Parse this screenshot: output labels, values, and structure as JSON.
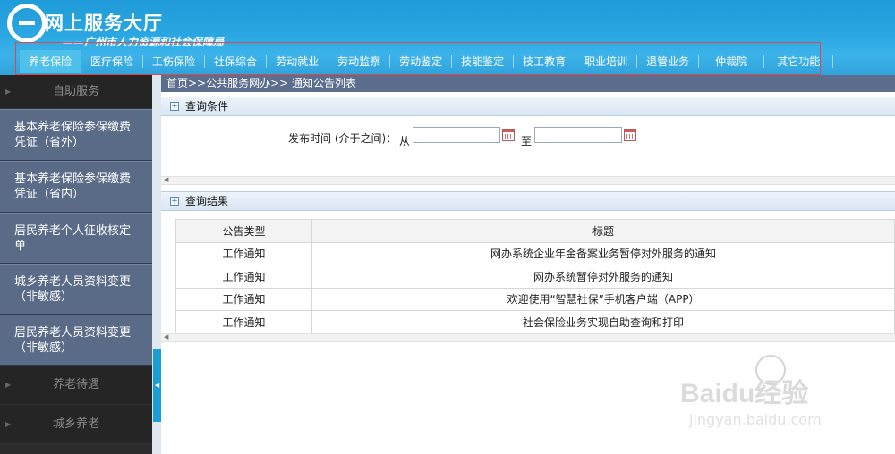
{
  "header": {
    "title": "网上服务大厅",
    "subtitle": "——广州市人力资源和社会保障局"
  },
  "nav": {
    "items": [
      {
        "label": "养老保险",
        "active": true
      },
      {
        "label": "医疗保险"
      },
      {
        "label": "工伤保险"
      },
      {
        "label": "社保综合"
      },
      {
        "label": "劳动就业"
      },
      {
        "label": "劳动监察"
      },
      {
        "label": "劳动鉴定"
      },
      {
        "label": "技能鉴定"
      },
      {
        "label": "技工教育"
      },
      {
        "label": "职业培训"
      },
      {
        "label": "退管业务"
      },
      {
        "label": "仲裁院"
      },
      {
        "label": "其它功能"
      }
    ]
  },
  "sidebar": {
    "section_self": "自助服务",
    "items": [
      {
        "label": "基本养老保险参保缴费凭证（省外）"
      },
      {
        "label": "基本养老保险参保缴费凭证（省内）"
      },
      {
        "label": "居民养老个人征收核定单"
      },
      {
        "label": "城乡养老人员资料变更（非敏感）"
      },
      {
        "label": "居民养老人员资料变更（非敏感）"
      }
    ],
    "section_benefit": "养老待遇",
    "section_rural": "城乡养老"
  },
  "main": {
    "breadcrumb": "首页>>公共服务网办>> 通知公告列表",
    "query": {
      "header": "查询条件",
      "label": "发布时间 (介于之间)：",
      "from_label": "从",
      "to_label": "至",
      "from_value": "",
      "to_value": ""
    },
    "results": {
      "header": "查询结果",
      "columns": [
        "公告类型",
        "标题"
      ],
      "rows": [
        [
          "工作通知",
          "网办系统企业年金备案业务暂停对外服务的通知"
        ],
        [
          "工作通知",
          "网办系统暂停对外服务的通知"
        ],
        [
          "工作通知",
          "欢迎使用“智慧社保”手机客户端（APP）"
        ],
        [
          "工作通知",
          "社会保险业务实现自助查询和打印"
        ]
      ]
    }
  },
  "watermark": {
    "text": "Baidu经验",
    "url": "jingyan.baidu.com"
  }
}
